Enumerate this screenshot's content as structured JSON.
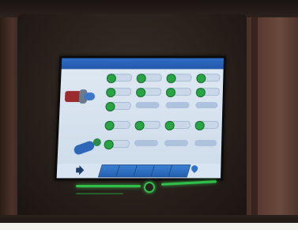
{
  "colors": {
    "screen_bg": "#d8e4f1",
    "title_bar": "#2a5fb4",
    "status_on": "#29a343",
    "led_green": "#2fbf4a",
    "wall": "#5b3c32"
  },
  "screen": {
    "title": "",
    "left_labels": [
      "",
      ""
    ],
    "buttons": [
      {
        "label": "",
        "state": "on"
      },
      {
        "label": "",
        "state": "on"
      },
      {
        "label": "",
        "state": "on"
      },
      {
        "label": "",
        "state": "on"
      },
      {
        "label": "",
        "state": "on"
      },
      {
        "label": "",
        "state": "on"
      },
      {
        "label": "",
        "state": "on"
      },
      {
        "label": "",
        "state": "on"
      },
      {
        "label": "",
        "state": "on"
      },
      {
        "label": "",
        "state": "on"
      },
      {
        "label": "",
        "state": "on"
      },
      {
        "label": "",
        "state": "on"
      },
      {
        "label": "",
        "state": "on"
      },
      {
        "label": "",
        "state": "on"
      }
    ],
    "footer": {
      "tabs": [
        "",
        "",
        "",
        "",
        ""
      ],
      "logo_text": ""
    }
  },
  "icons": [
    "pump-icon",
    "valve-icon",
    "speaker-icon",
    "logo-icon",
    "status-dot-icon"
  ]
}
